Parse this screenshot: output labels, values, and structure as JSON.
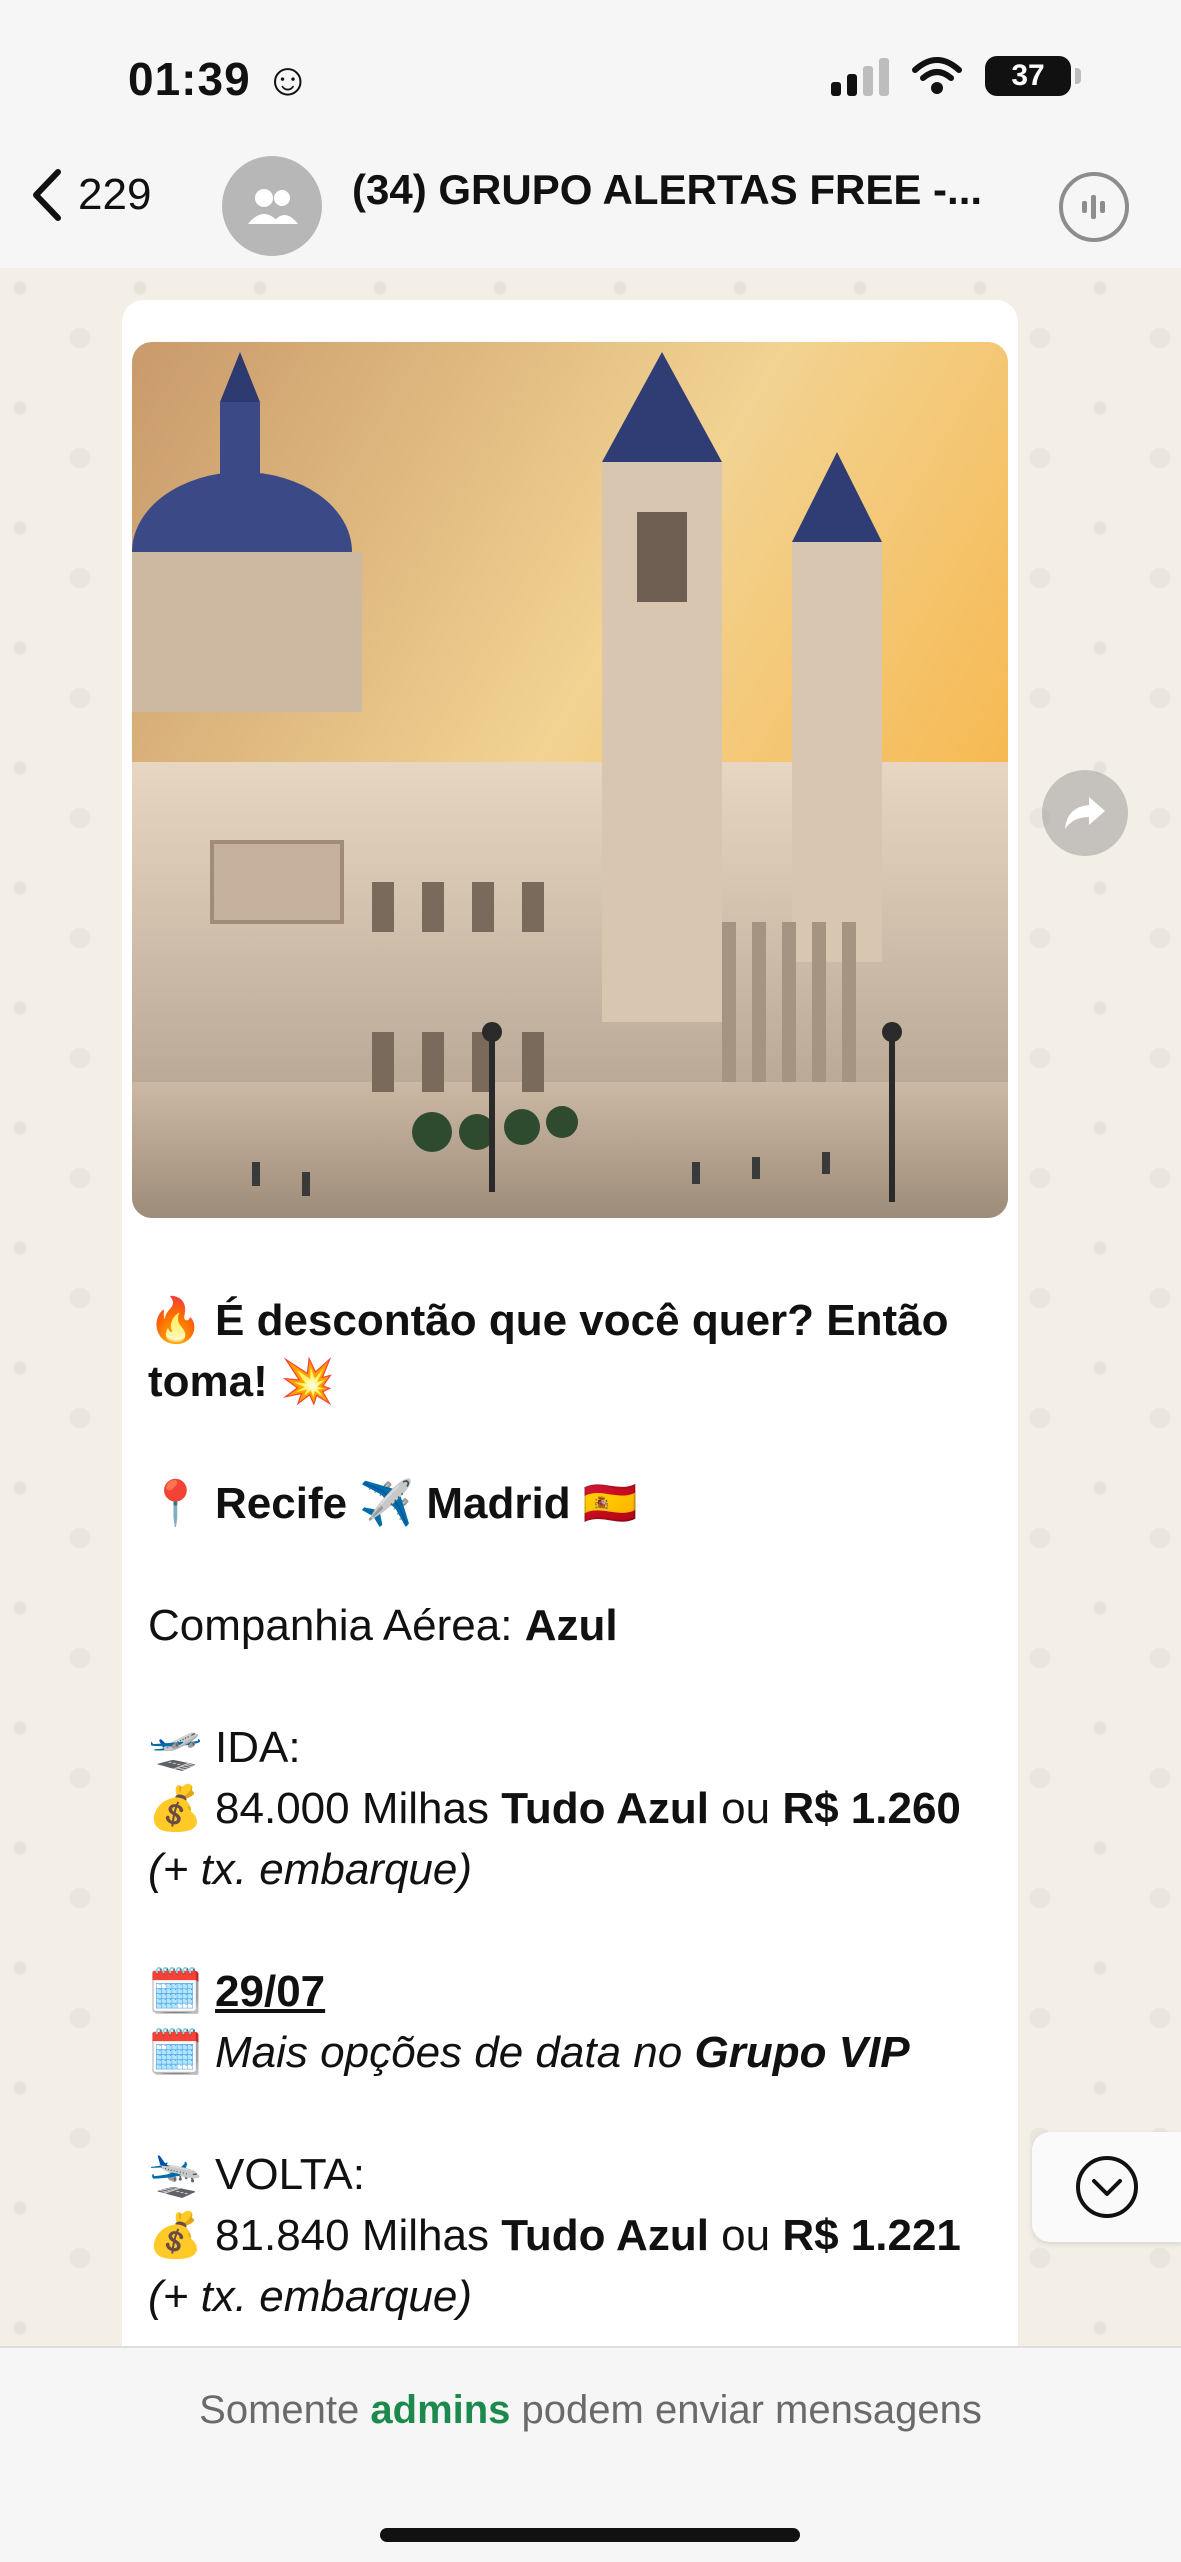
{
  "status": {
    "time": "01:39 ☺",
    "battery": "37"
  },
  "header": {
    "back_count": "229",
    "title": "(34) GRUPO ALERTAS FREE -..."
  },
  "message": {
    "line1": "🔥 É descontão que você quer? Então toma! 💥",
    "route": {
      "from": "Recife",
      "to": "Madrid",
      "pin": "📍",
      "plane": "✈️",
      "flag": "🇪🇸"
    },
    "airline_label": "Companhia Aérea: ",
    "airline": "Azul",
    "ida": {
      "label": "IDA:",
      "icon": "🛫",
      "money_icon": "💰",
      "miles": "84.000 Milhas ",
      "program": "Tudo Azul",
      "or": " ou ",
      "price": "R$ 1.260",
      "fee": "(+ tx. embarque)"
    },
    "dates": {
      "icon": "🗓️",
      "date": "29/07",
      "more_prefix": "Mais opções de data no ",
      "more_group": "Grupo VIP"
    },
    "volta": {
      "label": "VOLTA:",
      "icon": "🛬",
      "money_icon": "💰",
      "miles": "81.840 Milhas ",
      "program": "Tudo Azul",
      "or": " ou ",
      "price": "R$ 1.221",
      "fee": "(+ tx. embarque)"
    }
  },
  "footer": {
    "prefix": "Somente ",
    "admins": "admins",
    "suffix": " podem enviar mensagens"
  },
  "colors": {
    "accent": "#1b8a4c",
    "wallpaper": "#f4efe6"
  }
}
